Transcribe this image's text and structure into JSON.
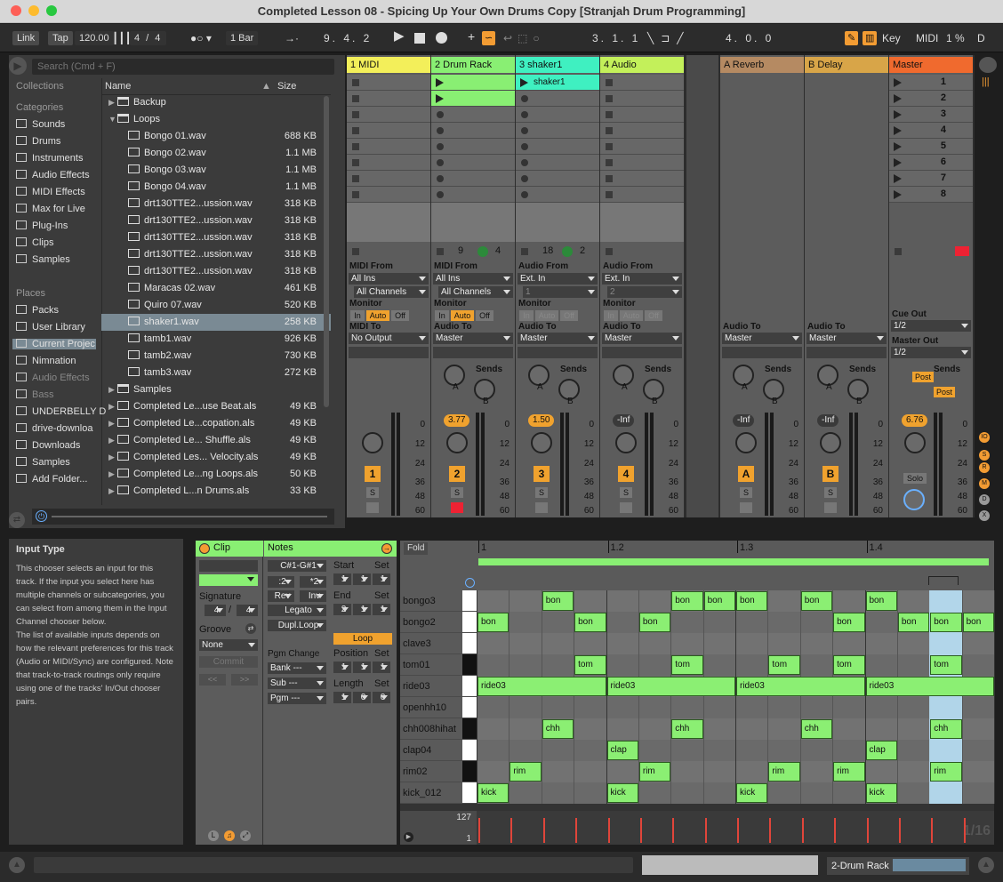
{
  "window": {
    "title": "Completed Lesson 08 - Spicing Up Your Own Drums Copy  [Stranjah Drum Programming]"
  },
  "control_bar": {
    "link": "Link",
    "tap": "Tap",
    "tempo": "120.00",
    "sig_num": "4",
    "sig_den": "4",
    "quantize": "1 Bar",
    "position": "9.  4.  2",
    "loop_start": "3.  1.  1",
    "loop_length": "4.  0.  0",
    "key": "Key",
    "midi": "MIDI",
    "cpu": "1 %",
    "d": "D"
  },
  "browser": {
    "search_placeholder": "Search (Cmd + F)",
    "collections_label": "Collections",
    "categories_label": "Categories",
    "categories": [
      "Sounds",
      "Drums",
      "Instruments",
      "Audio Effects",
      "MIDI Effects",
      "Max for Live",
      "Plug-Ins",
      "Clips",
      "Samples"
    ],
    "places_label": "Places",
    "places": [
      "Packs",
      "User Library",
      "Current Projec",
      "Nimnation",
      "Audio Effects",
      "Bass",
      "UNDERBELLY D",
      "drive-downloa",
      "Downloads",
      "Samples",
      "Add Folder..."
    ],
    "col_name": "Name",
    "col_size": "Size",
    "files": [
      {
        "n": "Backup",
        "s": "",
        "t": "f",
        "d": 0
      },
      {
        "n": "Loops",
        "s": "",
        "t": "f",
        "d": 0
      },
      {
        "n": "Bongo 01.wav",
        "s": "688 KB",
        "t": "w",
        "d": 1
      },
      {
        "n": "Bongo 02.wav",
        "s": "1.1 MB",
        "t": "w",
        "d": 1
      },
      {
        "n": "Bongo 03.wav",
        "s": "1.1 MB",
        "t": "w",
        "d": 1
      },
      {
        "n": "Bongo 04.wav",
        "s": "1.1 MB",
        "t": "w",
        "d": 1
      },
      {
        "n": "drt130TTE2...ussion.wav",
        "s": "318 KB",
        "t": "w",
        "d": 1
      },
      {
        "n": "drt130TTE2...ussion.wav",
        "s": "318 KB",
        "t": "w",
        "d": 1
      },
      {
        "n": "drt130TTE2...ussion.wav",
        "s": "318 KB",
        "t": "w",
        "d": 1
      },
      {
        "n": "drt130TTE2...ussion.wav",
        "s": "318 KB",
        "t": "w",
        "d": 1
      },
      {
        "n": "drt130TTE2...ussion.wav",
        "s": "318 KB",
        "t": "w",
        "d": 1
      },
      {
        "n": "Maracas 02.wav",
        "s": "461 KB",
        "t": "w",
        "d": 1
      },
      {
        "n": "Quiro 07.wav",
        "s": "520 KB",
        "t": "w",
        "d": 1
      },
      {
        "n": "shaker1.wav",
        "s": "258 KB",
        "t": "w",
        "d": 1
      },
      {
        "n": "tamb1.wav",
        "s": "926 KB",
        "t": "w",
        "d": 1
      },
      {
        "n": "tamb2.wav",
        "s": "730 KB",
        "t": "w",
        "d": 1
      },
      {
        "n": "tamb3.wav",
        "s": "272 KB",
        "t": "w",
        "d": 1
      },
      {
        "n": "Samples",
        "s": "",
        "t": "f",
        "d": 0
      },
      {
        "n": "Completed Le...use Beat.als",
        "s": "49 KB",
        "t": "a",
        "d": 0
      },
      {
        "n": "Completed Le...copation.als",
        "s": "49 KB",
        "t": "a",
        "d": 0
      },
      {
        "n": "Completed Le... Shuffle.als",
        "s": "49 KB",
        "t": "a",
        "d": 0
      },
      {
        "n": "Completed Les... Velocity.als",
        "s": "49 KB",
        "t": "a",
        "d": 0
      },
      {
        "n": "Completed Le...ng Loops.als",
        "s": "50 KB",
        "t": "a",
        "d": 0
      },
      {
        "n": "Completed L...n Drums.als",
        "s": "33 KB",
        "t": "a",
        "d": 0
      }
    ]
  },
  "tracks": [
    {
      "name": "1 MIDI",
      "color": "#f3ef5a",
      "num": "1",
      "from_label": "MIDI From",
      "from": "All Ins",
      "chan": "All Channels",
      "to_label": "MIDI To",
      "to": "No Output",
      "val": ""
    },
    {
      "name": "2 Drum Rack",
      "color": "#89ef73",
      "num": "2",
      "from_label": "MIDI From",
      "from": "All Ins",
      "chan": "All Channels",
      "to_label": "Audio To",
      "to": "Master",
      "val": "3.77",
      "c1": "9",
      "c2": "4"
    },
    {
      "name": "3 shaker1",
      "color": "#3ff0c1",
      "num": "3",
      "from_label": "Audio From",
      "from": "Ext. In",
      "chan": "1",
      "to_label": "Audio To",
      "to": "Master",
      "val": "1.50",
      "clip": "shaker1",
      "c1": "18",
      "c2": "2"
    },
    {
      "name": "4 Audio",
      "color": "#c3f05a",
      "num": "4",
      "from_label": "Audio From",
      "from": "Ext. In",
      "chan": "2",
      "to_label": "Audio To",
      "to": "Master",
      "val": "-Inf"
    }
  ],
  "returns": [
    {
      "name": "A Reverb",
      "num": "A",
      "val": "-Inf"
    },
    {
      "name": "B Delay",
      "num": "B",
      "val": "-Inf"
    }
  ],
  "master": {
    "name": "Master",
    "scenes": [
      "1",
      "2",
      "3",
      "4",
      "5",
      "6",
      "7",
      "8"
    ],
    "cue_label": "Cue Out",
    "cue": "1/2",
    "out_label": "Master Out",
    "out": "1/2",
    "val": "6.76",
    "solo": "Solo",
    "post": "Post"
  },
  "mixer": {
    "monitor": "Monitor",
    "in": "In",
    "auto": "Auto",
    "off": "Off",
    "sends": "Sends",
    "a": "A",
    "b": "B",
    "s": "S",
    "scale": [
      "0",
      "12",
      "24",
      "36",
      "48",
      "60"
    ]
  },
  "info": {
    "title": "Input Type",
    "body1": "This chooser selects an input for this track. If the input you select here has multiple channels or subcategories, you can select from among them in the Input Channel chooser below.",
    "body2": "The list of available inputs depends on how the relevant preferences for this track (Audio or MIDI/Sync) are configured. Note that track-to-track routings only require using one of the tracks' In/Out chooser pairs."
  },
  "clip": {
    "clip_label": "Clip",
    "notes_label": "Notes",
    "range": "C#1-G#1",
    "signature": "Signature",
    "sig_num": "4",
    "sig_den": "4",
    "groove": "Groove",
    "groove_val": "None",
    "commit": "Commit",
    "half": ":2",
    "double": "*2",
    "rev": "Rev",
    "inv": "Inv",
    "legato": "Legato",
    "dupl": "Dupl.Loop",
    "start": "Start",
    "end": "End",
    "set": "Set",
    "start_v": [
      "1",
      "1",
      "1"
    ],
    "end_v": [
      "2",
      "1",
      "1"
    ],
    "loop": "Loop",
    "position": "Position",
    "length": "Length",
    "pos_v": [
      "1",
      "1",
      "1"
    ],
    "len_v": [
      "1",
      "0",
      "0"
    ],
    "pgm_change": "Pgm Change",
    "bank": "Bank ---",
    "sub": "Sub ---",
    "pgm": "Pgm ---"
  },
  "editor": {
    "fold": "Fold",
    "bars": [
      "1",
      "1.2",
      "1.3",
      "1.4"
    ],
    "vel_top": "127",
    "vel_bottom": "1",
    "grid": "1/16",
    "lanes": [
      "bongo3",
      "bongo2",
      "clave3",
      "tom01",
      "ride03",
      "openhh10",
      "chh008hihat",
      "clap04",
      "rim02",
      "kick_012"
    ],
    "notes": [
      {
        "l": 0,
        "s": 2,
        "e": 3,
        "t": "bon"
      },
      {
        "l": 0,
        "s": 6,
        "e": 7,
        "t": "bon"
      },
      {
        "l": 0,
        "s": 7,
        "e": 8,
        "t": "bon"
      },
      {
        "l": 0,
        "s": 8,
        "e": 9,
        "t": "bon"
      },
      {
        "l": 0,
        "s": 10,
        "e": 11,
        "t": "bon"
      },
      {
        "l": 0,
        "s": 12,
        "e": 13,
        "t": "bon"
      },
      {
        "l": 1,
        "s": 0,
        "e": 1,
        "t": "bon"
      },
      {
        "l": 1,
        "s": 3,
        "e": 4,
        "t": "bon"
      },
      {
        "l": 1,
        "s": 5,
        "e": 6,
        "t": "bon"
      },
      {
        "l": 1,
        "s": 11,
        "e": 12,
        "t": "bon"
      },
      {
        "l": 1,
        "s": 13,
        "e": 14,
        "t": "bon"
      },
      {
        "l": 1,
        "s": 14,
        "e": 15,
        "t": "bon"
      },
      {
        "l": 1,
        "s": 15,
        "e": 16,
        "t": "bon"
      },
      {
        "l": 3,
        "s": 3,
        "e": 4,
        "t": "tom"
      },
      {
        "l": 3,
        "s": 6,
        "e": 7,
        "t": "tom"
      },
      {
        "l": 3,
        "s": 9,
        "e": 10,
        "t": "tom"
      },
      {
        "l": 3,
        "s": 11,
        "e": 12,
        "t": "tom"
      },
      {
        "l": 3,
        "s": 14,
        "e": 15,
        "t": "tom"
      },
      {
        "l": 4,
        "s": 0,
        "e": 4,
        "t": "ride03"
      },
      {
        "l": 4,
        "s": 4,
        "e": 8,
        "t": "ride03"
      },
      {
        "l": 4,
        "s": 8,
        "e": 12,
        "t": "ride03"
      },
      {
        "l": 4,
        "s": 12,
        "e": 16,
        "t": "ride03"
      },
      {
        "l": 6,
        "s": 2,
        "e": 3,
        "t": "chh"
      },
      {
        "l": 6,
        "s": 6,
        "e": 7,
        "t": "chh"
      },
      {
        "l": 6,
        "s": 10,
        "e": 11,
        "t": "chh"
      },
      {
        "l": 6,
        "s": 14,
        "e": 15,
        "t": "chh"
      },
      {
        "l": 7,
        "s": 4,
        "e": 5,
        "t": "clap"
      },
      {
        "l": 7,
        "s": 12,
        "e": 13,
        "t": "clap"
      },
      {
        "l": 8,
        "s": 1,
        "e": 2,
        "t": "rim"
      },
      {
        "l": 8,
        "s": 5,
        "e": 6,
        "t": "rim"
      },
      {
        "l": 8,
        "s": 9,
        "e": 10,
        "t": "rim"
      },
      {
        "l": 8,
        "s": 11,
        "e": 12,
        "t": "rim"
      },
      {
        "l": 8,
        "s": 14,
        "e": 15,
        "t": "rim"
      },
      {
        "l": 9,
        "s": 0,
        "e": 1,
        "t": "kick"
      },
      {
        "l": 9,
        "s": 4,
        "e": 5,
        "t": "kick"
      },
      {
        "l": 9,
        "s": 8,
        "e": 9,
        "t": "kick"
      },
      {
        "l": 9,
        "s": 12,
        "e": 13,
        "t": "kick"
      }
    ]
  },
  "status": {
    "device": "2-Drum Rack"
  },
  "colors": {
    "accent": "#f39c33",
    "clip_green": "#89ef73",
    "selected_col": "#bde8ff"
  }
}
